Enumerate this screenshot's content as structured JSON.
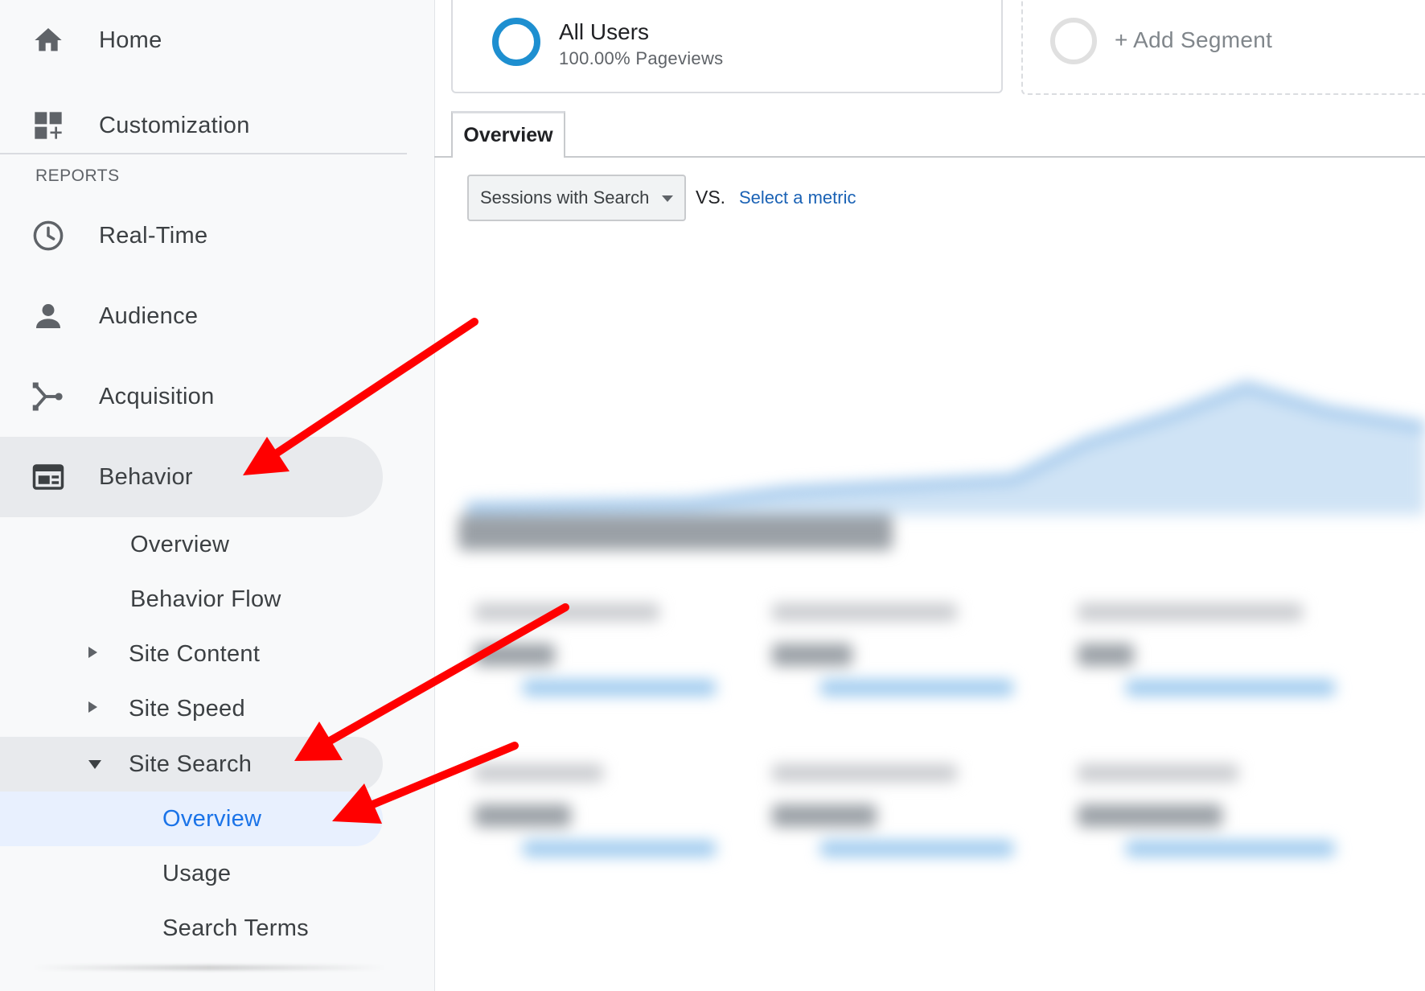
{
  "sidebar": {
    "items": [
      {
        "label": "Home",
        "icon": "home-icon"
      },
      {
        "label": "Customization",
        "icon": "customization-icon"
      },
      {
        "label": "Real-Time",
        "icon": "clock-icon"
      },
      {
        "label": "Audience",
        "icon": "person-icon"
      },
      {
        "label": "Acquisition",
        "icon": "acquisition-icon"
      },
      {
        "label": "Behavior",
        "icon": "behavior-icon"
      }
    ],
    "section_label": "REPORTS",
    "behavior_sub": [
      {
        "label": "Overview"
      },
      {
        "label": "Behavior Flow"
      },
      {
        "label": "Site Content"
      },
      {
        "label": "Site Speed"
      },
      {
        "label": "Site Search"
      }
    ],
    "site_search_sub": [
      {
        "label": "Overview"
      },
      {
        "label": "Usage"
      },
      {
        "label": "Search Terms"
      }
    ]
  },
  "segments": {
    "active": {
      "title": "All Users",
      "subtitle": "100.00% Pageviews"
    },
    "add_label": "+ Add Segment"
  },
  "tabs": [
    {
      "label": "Overview"
    }
  ],
  "metric": {
    "selected": "Sessions with Search",
    "vs_label": "VS.",
    "select_link": "Select a metric"
  },
  "colors": {
    "accent_blue": "#1a73e8",
    "segment_ring": "#1e8fd0",
    "arrow_red": "#ff0000",
    "sidebar_bg": "#f8f9fa"
  }
}
